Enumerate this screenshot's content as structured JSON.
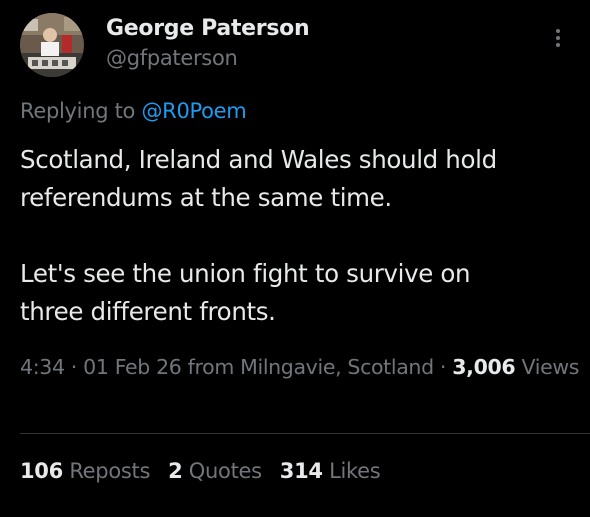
{
  "author": {
    "display_name": "George Paterson",
    "handle": "@gfpaterson"
  },
  "reply": {
    "prefix": "Replying to ",
    "mention": "@R0Poem"
  },
  "tweet": {
    "paragraph_1": "Scotland, Ireland and Wales should hold\nreferendums at the same time.",
    "paragraph_2": "Let's see the union fight to survive on\nthree different fronts."
  },
  "meta": {
    "time": "4:34",
    "separator_1": " · ",
    "date": "01 Feb 26",
    "location": " from Milngavie, Scotland",
    "separator_2": " · ",
    "views_count": "3,006",
    "views_label": "Views"
  },
  "stats": {
    "reposts_count": "106",
    "reposts_label": "Reposts",
    "quotes_count": "2",
    "quotes_label": "Quotes",
    "likes_count": "314",
    "likes_label": "Likes"
  },
  "icons": {
    "more": "more-vertical-icon"
  },
  "colors": {
    "background": "#000000",
    "primary_text": "#e7e9ea",
    "secondary_text": "#71767b",
    "link": "#1d9bf0",
    "divider": "#2f3336"
  }
}
